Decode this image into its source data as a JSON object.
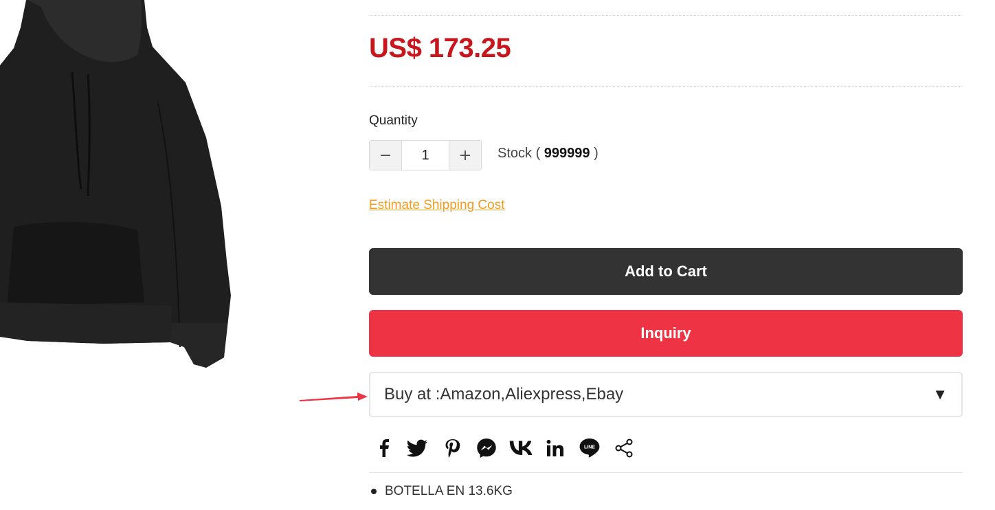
{
  "product": {
    "price": "US$ 173.25",
    "image_icon": "hoodie-image"
  },
  "quantity": {
    "label": "Quantity",
    "value": "1",
    "minus_icon": "minus-icon",
    "plus_icon": "plus-icon"
  },
  "stock": {
    "prefix": "Stock ( ",
    "value": "999999",
    "suffix": " )"
  },
  "shipping": {
    "link_label": "Estimate Shipping Cost",
    "color": "#f39b1d"
  },
  "buttons": {
    "add_to_cart": "Add to Cart",
    "inquiry": "Inquiry",
    "cart_color": "#333333",
    "inquiry_color": "#ee3344"
  },
  "buy_at": {
    "label": "Buy at :Amazon,Aliexpress,Ebay",
    "caret": "▼"
  },
  "share_icons": [
    "facebook-icon",
    "twitter-icon",
    "pinterest-icon",
    "messenger-icon",
    "vk-icon",
    "linkedin-icon",
    "line-icon",
    "share-icon"
  ],
  "details": {
    "bullet_1": "BOTELLA EN 13.6KG"
  },
  "accent_colors": {
    "price": "#c8161d",
    "annotation_arrow": "#ee3344"
  }
}
